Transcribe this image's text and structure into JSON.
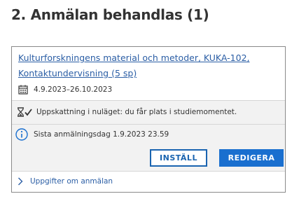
{
  "section": {
    "title": "2. Anmälan behandlas (1)"
  },
  "card": {
    "course_title": "Kulturforskningens material och metoder, KUKA-102, Kontaktundervisning (5 sp)",
    "dates": "4.9.2023–26.10.2023",
    "status_text": "Uppskattning i nuläget: du får plats i studiemomentet.",
    "deadline_text": "Sista anmälningsdag 1.9.2023 23.59",
    "cancel_label": "INSTÄLL",
    "edit_label": "REDIGERA",
    "details_label": "Uppgifter om anmälan"
  },
  "colors": {
    "link": "#2b5ea5",
    "primary": "#1a6fcf",
    "panel_bg": "#f2f2f2",
    "border": "#8a8a8a"
  },
  "icons": {
    "calendar": "calendar-icon",
    "status": "hourglass-check-icon",
    "info": "info-icon",
    "expand": "chevron-right-icon"
  }
}
